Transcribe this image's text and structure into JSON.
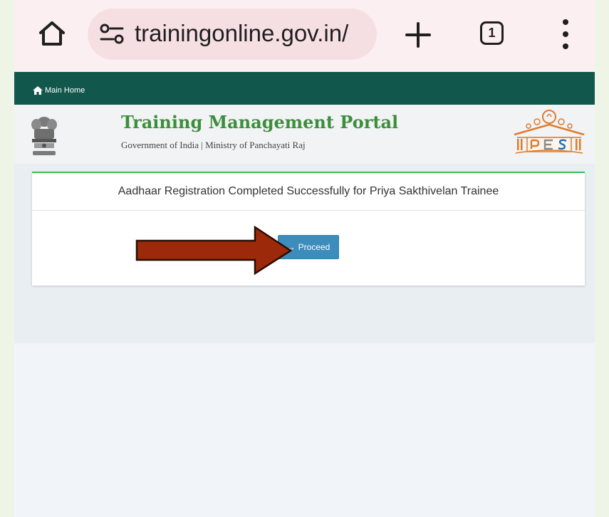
{
  "browser": {
    "url": "trainingonline.gov.in/",
    "tab_count": "1",
    "icons": [
      "home-icon",
      "site-settings-icon",
      "new-tab-plus-icon",
      "tab-switcher-icon",
      "more-vert-icon"
    ]
  },
  "topbar": {
    "home_link": "Main Home",
    "background_color": "#12574b"
  },
  "header": {
    "title": "Training Management Portal",
    "subtitle": "Government of India | Ministry of Panchayati Raj",
    "title_color": "#3c8d3c"
  },
  "card": {
    "message": "Aadhaar Registration Completed Successfully for Priya Sakthivelan Trainee",
    "proceed_label": "Proceed",
    "button_color": "#3c8dbc"
  },
  "annotation": {
    "arrow_color": "#9c2a0a"
  }
}
